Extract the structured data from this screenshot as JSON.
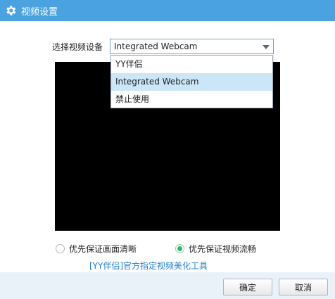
{
  "window": {
    "title": "视频设置",
    "icon": "gear-icon"
  },
  "device": {
    "label": "选择视频设备",
    "selected": "Integrated Webcam",
    "options": [
      "YY伴侣",
      "Integrated Webcam",
      "禁止使用"
    ]
  },
  "quality": {
    "option_clear": "优先保证画面清晰",
    "option_smooth": "优先保证视频流畅",
    "selected": "优先保证视频流畅"
  },
  "link_text": "[YY伴侣]官方指定视频美化工具",
  "buttons": {
    "ok": "确定",
    "cancel": "取消"
  },
  "colors": {
    "titlebar": "#4aa3e0",
    "selection": "#cbe6f7",
    "radio_on": "#2fb86c",
    "link": "#1b7ed6"
  }
}
